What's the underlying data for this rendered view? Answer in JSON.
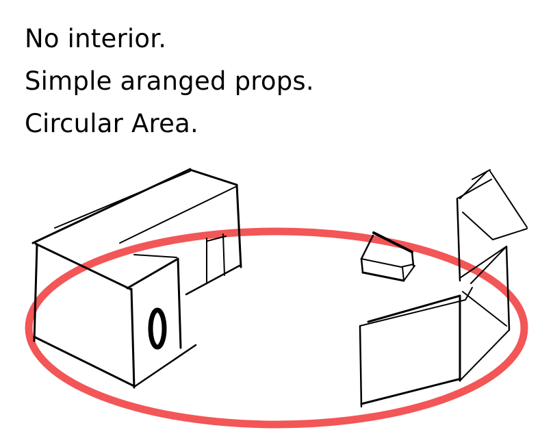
{
  "notes": {
    "lines": [
      "No interior.",
      "Simple aranged props.",
      "Circular Area."
    ]
  },
  "colors": {
    "area_ring": "#f25656",
    "ink": "#000000",
    "background": "#ffffff"
  },
  "figure": {
    "props": [
      {
        "name": "large-box-prop",
        "label": "0"
      },
      {
        "name": "small-cube-prop"
      },
      {
        "name": "open-crate-prop"
      }
    ]
  }
}
